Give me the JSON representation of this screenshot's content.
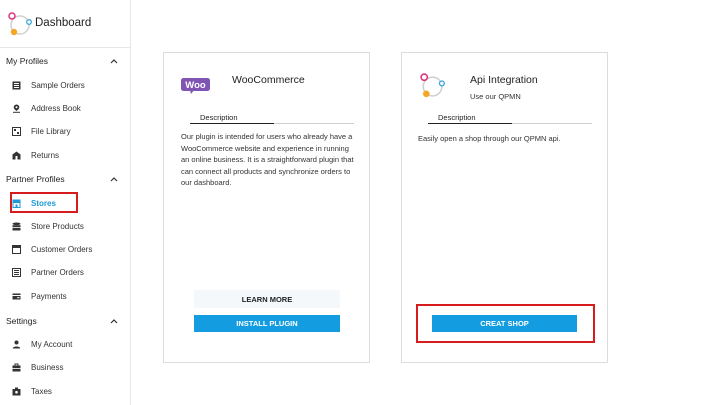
{
  "brand": {
    "title": "Dashboard"
  },
  "sidebar": {
    "sections": [
      {
        "title": "My Profiles",
        "items": [
          {
            "label": "Sample Orders",
            "icon": "list-icon"
          },
          {
            "label": "Address Book",
            "icon": "location-pin-icon"
          },
          {
            "label": "File Library",
            "icon": "file-library-icon"
          },
          {
            "label": "Returns",
            "icon": "returns-icon"
          }
        ]
      },
      {
        "title": "Partner Profiles",
        "items": [
          {
            "label": "Stores",
            "icon": "store-icon",
            "active": true
          },
          {
            "label": "Store Products",
            "icon": "stack-icon"
          },
          {
            "label": "Customer Orders",
            "icon": "window-icon"
          },
          {
            "label": "Partner Orders",
            "icon": "grid-list-icon"
          },
          {
            "label": "Payments",
            "icon": "payments-icon"
          }
        ]
      },
      {
        "title": "Settings",
        "items": [
          {
            "label": "My Account",
            "icon": "user-icon"
          },
          {
            "label": "Business",
            "icon": "briefcase-icon"
          },
          {
            "label": "Taxes",
            "icon": "taxes-icon"
          }
        ]
      }
    ]
  },
  "cards": {
    "woo": {
      "logo_text": "Woo",
      "title": "WooCommerce",
      "tab": "Description",
      "description": "Our plugin is intended for users who already have a WooCommerce website and experience in running an online business. It is a straightforward plugin that can connect all products and synchronize orders to our dashboard.",
      "learn_more": "LEARN MORE",
      "install": "INSTALL PLUGIN"
    },
    "api": {
      "title": "Api Integration",
      "subtitle": "Use our QPMN",
      "tab": "Description",
      "description": "Easily open a shop through our QPMN api.",
      "creat": "CREAT SHOP"
    }
  },
  "colors": {
    "accent": "#139ce0",
    "active_nav": "#1a9ad6",
    "highlight": "#d61c1c",
    "woo_purple": "#7f54b3"
  }
}
